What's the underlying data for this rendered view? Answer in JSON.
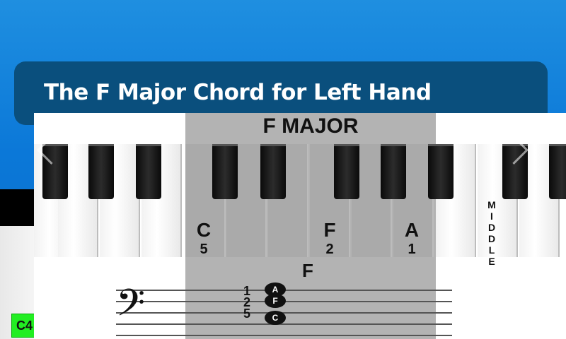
{
  "title": "The F Major Chord for Left Hand",
  "chord": {
    "name": "F MAJOR",
    "staff_label": "F"
  },
  "keys": [
    {
      "letter": "C",
      "finger": "5"
    },
    {
      "letter": "F",
      "finger": "2"
    },
    {
      "letter": "A",
      "finger": "1"
    }
  ],
  "middle_label": [
    "M",
    "I",
    "D",
    "D",
    "L",
    "E"
  ],
  "staff_fingers": [
    "1",
    "2",
    "5"
  ],
  "notes": [
    "A",
    "F",
    "C"
  ],
  "badge": "C4",
  "colors": {
    "highlight": "#969696",
    "badge": "#22ee22",
    "title_bar": "#0a4f7d"
  }
}
